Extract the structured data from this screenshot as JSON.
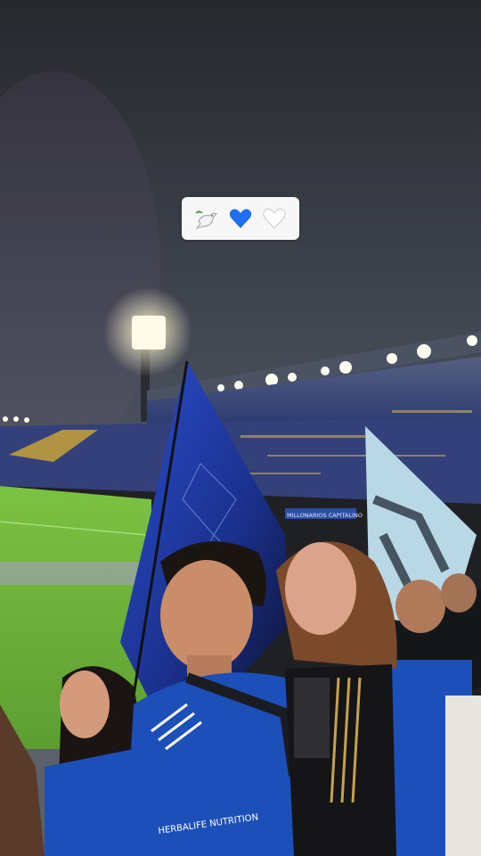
{
  "photo": {
    "kind": "stadium-night-crowd",
    "colors": {
      "sky_top": "#2a2c30",
      "sky_bottom": "#3b3f48",
      "pitch": "#6fb23a",
      "pitch_shadow": "#4f8f2a",
      "stands": "#3a4a7a",
      "flag_blue": "#1f3fa8",
      "jersey_blue": "#1d4fb8",
      "floodlight": "#fffbe8"
    }
  },
  "stadium_ad_banner": "MILLONARIOS CAPITALINO",
  "jersey_sponsor": "HERBALIFE NUTRITION",
  "sticker": {
    "emojis": [
      {
        "icon": "dove-icon",
        "glyph": "🕊️"
      },
      {
        "icon": "blue-heart-icon",
        "glyph": "💙"
      },
      {
        "icon": "white-heart-icon",
        "glyph": "🤍"
      }
    ]
  }
}
